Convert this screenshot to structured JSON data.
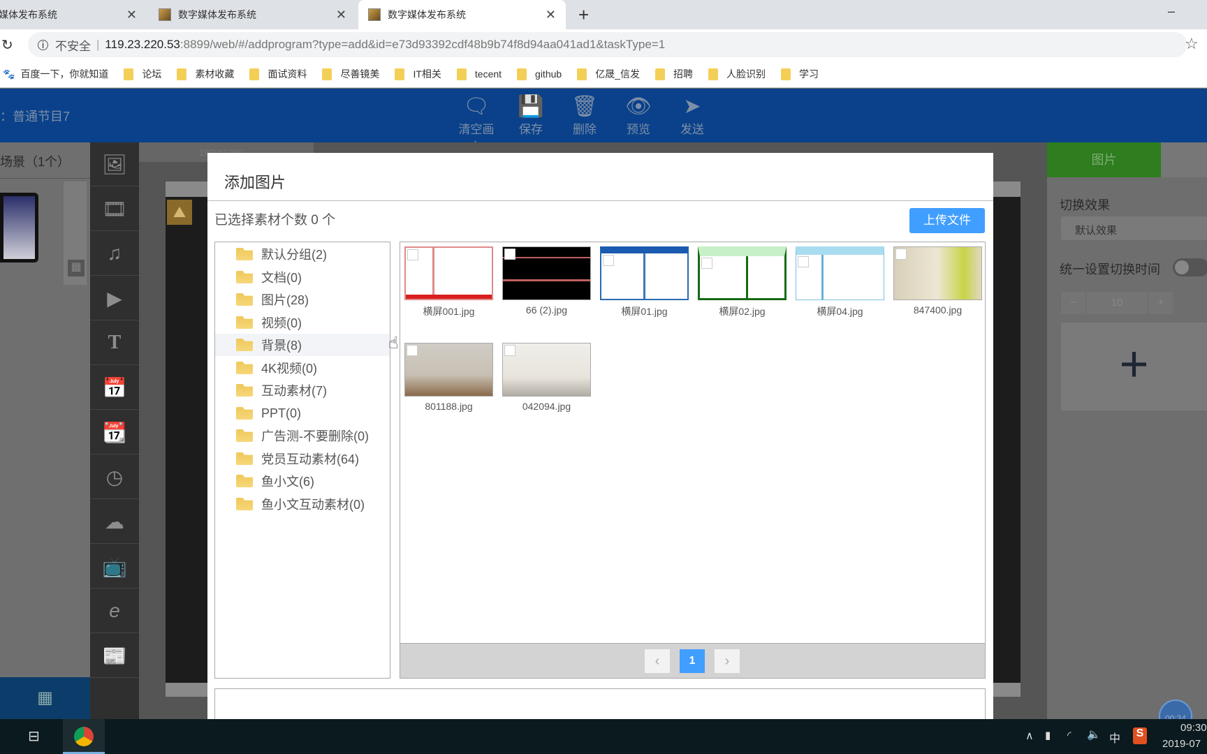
{
  "browser": {
    "tabs": [
      {
        "title": "数字媒体发布系统"
      },
      {
        "title": "数字媒体发布系统"
      },
      {
        "title": "数字媒体发布系统",
        "active": true
      }
    ],
    "new_tab": "+",
    "security": "不安全",
    "url_host": "119.23.220.53",
    "url_rest": ":8899/web/#/addprogram?type=add&id=e73d93392cdf48b9b74f8d94aa041ad1&taskType=1",
    "bookmarks": [
      "百度一下，你就知道",
      "论坛",
      "素材收藏",
      "面试资料",
      "尽善镜美",
      "IT相关",
      "tecent",
      "github",
      "亿晟_信发",
      "招聘",
      "人脸识别",
      "学习"
    ]
  },
  "header": {
    "program_name": "：普通节目7",
    "tools": [
      {
        "label": "清空画布",
        "icon": "clear-canvas-icon"
      },
      {
        "label": "保存",
        "icon": "save-icon"
      },
      {
        "label": "删除",
        "icon": "trash-icon"
      },
      {
        "label": "预览",
        "icon": "eye-icon"
      },
      {
        "label": "发送",
        "icon": "send-icon"
      }
    ]
  },
  "left_panel": {
    "title": "场景（1个）"
  },
  "canvas": {
    "resolution": "1920*1080"
  },
  "right_panel": {
    "tabs": [
      "图片"
    ],
    "transition_label": "切换效果",
    "transition_value": "默认效果",
    "uniform_time_label": "统一设置切换时间",
    "uniform_time_on": false,
    "time_value": "10",
    "minus": "−",
    "plus": "+",
    "add": "+"
  },
  "modal": {
    "title": "添加图片",
    "selected_count": "已选择素材个数 0 个",
    "upload": "上传文件",
    "folders": [
      "默认分组(2)",
      "文档(0)",
      "图片(28)",
      "视频(0)",
      "背景(8)",
      "4K视频(0)",
      "互动素材(7)",
      "PPT(0)",
      "广告测-不要删除(0)",
      "党员互动素材(64)",
      "鱼小文(6)",
      "鱼小文互动素材(0)"
    ],
    "hovered_folder": "背景(8)",
    "images": [
      "横屏001.jpg",
      "66 (2).jpg",
      "横屏01.jpg",
      "横屏02.jpg",
      "横屏04.jpg",
      "847400.jpg",
      "801188.jpg",
      "042094.jpg"
    ],
    "pagination": {
      "prev": "‹",
      "current": "1",
      "next": "›"
    }
  },
  "taskbar": {
    "time": "09:30",
    "date": "2019-07",
    "ime": "中",
    "timer": "00:34"
  },
  "colors": {
    "header": "#0a418a",
    "accent": "#409eff",
    "right_tab": "#2e7d1f"
  }
}
